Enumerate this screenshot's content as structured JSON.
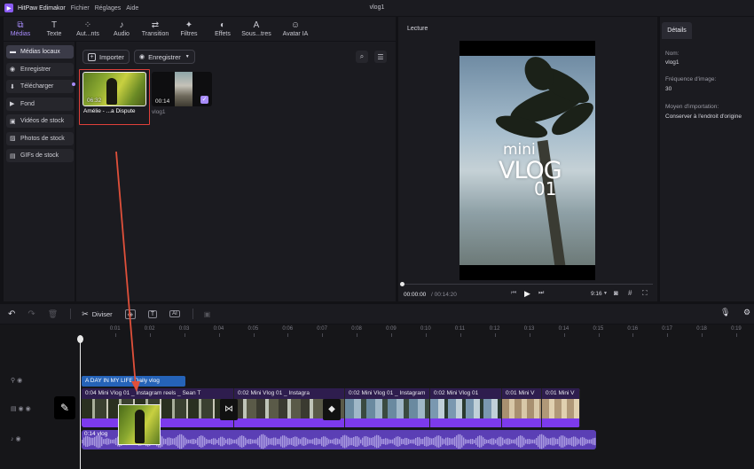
{
  "titlebar": {
    "app_name": "HitPaw Edimakor",
    "menus": [
      "Fichier",
      "Réglages",
      "Aide"
    ],
    "window_title": "vlog1"
  },
  "toolbar": {
    "tools": [
      {
        "label": "Médias",
        "icon": "media-icon",
        "glyph": "⧉"
      },
      {
        "label": "Texte",
        "icon": "text-icon",
        "glyph": "T"
      },
      {
        "label": "Aut...nts",
        "icon": "elements-icon",
        "glyph": "⁘"
      },
      {
        "label": "Audio",
        "icon": "audio-icon",
        "glyph": "♪"
      },
      {
        "label": "Transition",
        "icon": "transition-icon",
        "glyph": "⇄"
      },
      {
        "label": "Filtres",
        "icon": "filters-icon",
        "glyph": "✦"
      },
      {
        "label": "Effets",
        "icon": "effects-icon",
        "glyph": "◐"
      },
      {
        "label": "Sous...tres",
        "icon": "subtitles-icon",
        "glyph": "A"
      },
      {
        "label": "Avatar IA",
        "icon": "avatar-icon",
        "glyph": "☺"
      }
    ]
  },
  "sidebar": {
    "items": [
      {
        "label": "Médias locaux",
        "icon": "folder-icon",
        "glyph": "▬"
      },
      {
        "label": "Enregistrer",
        "icon": "record-icon",
        "glyph": "◉"
      },
      {
        "label": "Télécharger",
        "icon": "download-icon",
        "glyph": "⬇"
      },
      {
        "label": "Fond",
        "icon": "background-icon",
        "glyph": "▶"
      },
      {
        "label": "Vidéos de stock",
        "icon": "stock-video-icon",
        "glyph": "▣"
      },
      {
        "label": "Photos de stock",
        "icon": "stock-photo-icon",
        "glyph": "▨"
      },
      {
        "label": "GIFs de stock",
        "icon": "gif-icon",
        "glyph": "▤"
      }
    ]
  },
  "media": {
    "import_label": "Importer",
    "record_label": "Enregistrer",
    "items": [
      {
        "duration": "06:32",
        "name": "Amélie - ...a Dispute"
      },
      {
        "duration": "00:14",
        "name": "vlog1"
      }
    ]
  },
  "preview": {
    "header": "Lecture",
    "overlay_mini": "mini",
    "overlay_vlog": "VLOG",
    "overlay_num": "01",
    "time_current": "00:00:00",
    "time_total": "/ 00:14:20",
    "aspect": "9:16"
  },
  "details": {
    "tab": "Détails",
    "fields": [
      {
        "label": "Nom:",
        "value": "vlog1"
      },
      {
        "label": "Fréquence d'image:",
        "value": "30"
      },
      {
        "label": "Moyen d'importation:",
        "value": "Conserver à l'endroit d'origine"
      }
    ]
  },
  "timeline_toolbar": {
    "split_label": "Diviser"
  },
  "timeline": {
    "ruler_ticks": [
      "0:01",
      "0:02",
      "0:03",
      "0:04",
      "0:05",
      "0:06",
      "0:07",
      "0:08",
      "0:09",
      "0:10",
      "0:11",
      "0:12",
      "0:13",
      "0:14",
      "0:15",
      "0:16",
      "0:17",
      "0:18",
      "0:19"
    ],
    "text_clip": "A DAY IN MY LIFE Daily vlog",
    "video_clips": [
      "0:04 Mini Vlog 01 _ Instagram reels _ Sean T",
      "0:02 Mini Vlog 01 _ Instagra",
      "0:02 Mini Vlog 01 _ Instagram",
      "0:02 Mini Vlog 01",
      "0:01 Mini V",
      "0:01 Mini V"
    ],
    "audio_label": "0:14 vlog"
  },
  "colors": {
    "accent": "#a78bfa",
    "highlight_border": "#e0403a",
    "arrow": "#e0503a"
  }
}
